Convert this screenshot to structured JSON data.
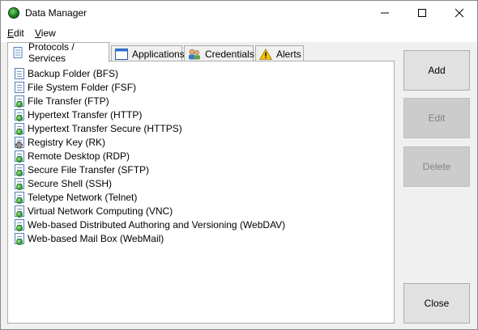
{
  "window": {
    "title": "Data Manager",
    "minimize_glyph": "—",
    "maximize_glyph": "☐",
    "close_glyph": "✕"
  },
  "menu": [
    {
      "label_accel": "E",
      "label_rest": "dit"
    },
    {
      "label_accel": "V",
      "label_rest": "iew"
    }
  ],
  "tabs": [
    {
      "label": "Protocols / Services",
      "icon": "document-icon",
      "active": true
    },
    {
      "label": "Applications",
      "icon": "window-icon",
      "active": false
    },
    {
      "label": "Credentials",
      "icon": "users-icon",
      "active": false
    },
    {
      "label": "Alerts",
      "icon": "warning-icon",
      "active": false
    }
  ],
  "protocols": [
    {
      "label": "Backup Folder (BFS)",
      "icon": "document-icon"
    },
    {
      "label": "File System Folder (FSF)",
      "icon": "document-icon"
    },
    {
      "label": "File Transfer (FTP)",
      "icon": "globe-document-icon"
    },
    {
      "label": "Hypertext Transfer (HTTP)",
      "icon": "globe-document-icon"
    },
    {
      "label": "Hypertext Transfer Secure (HTTPS)",
      "icon": "globe-document-icon"
    },
    {
      "label": "Registry Key (RK)",
      "icon": "gear-document-icon"
    },
    {
      "label": "Remote Desktop (RDP)",
      "icon": "globe-document-icon"
    },
    {
      "label": "Secure File Transfer (SFTP)",
      "icon": "globe-document-icon"
    },
    {
      "label": "Secure Shell (SSH)",
      "icon": "globe-document-icon"
    },
    {
      "label": "Teletype Network (Telnet)",
      "icon": "globe-document-icon"
    },
    {
      "label": "Virtual Network Computing (VNC)",
      "icon": "globe-document-icon"
    },
    {
      "label": "Web-based Distributed Authoring and Versioning (WebDAV)",
      "icon": "globe-document-icon"
    },
    {
      "label": "Web-based Mail Box (WebMail)",
      "icon": "globe-document-icon"
    }
  ],
  "buttons": {
    "add": "Add",
    "edit": "Edit",
    "delete": "Delete",
    "close": "Close"
  },
  "colors": {
    "window_bg": "#f0f0f0",
    "list_bg": "#ffffff",
    "button_bg": "#e1e1e1",
    "button_disabled_bg": "#cccccc",
    "disabled_text": "#838383"
  }
}
